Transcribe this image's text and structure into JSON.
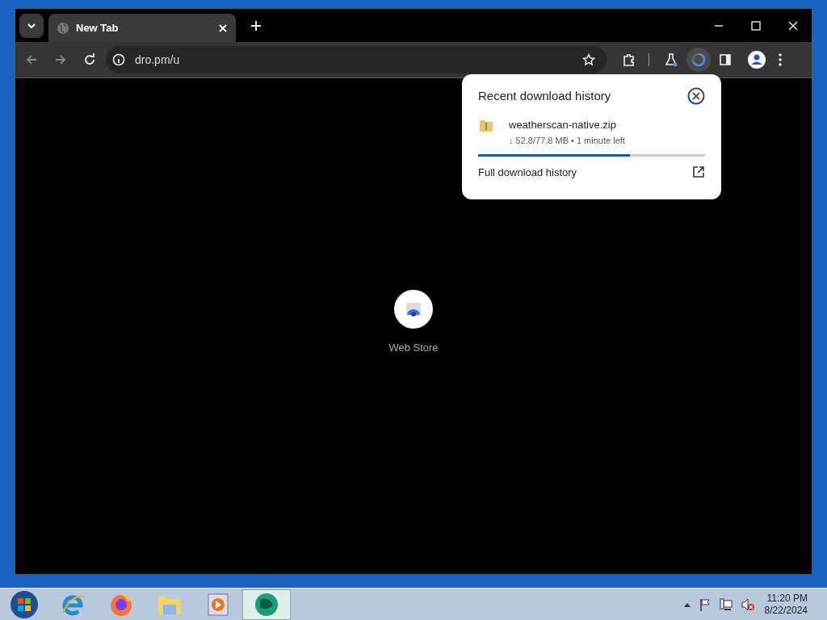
{
  "tab": {
    "title": "New Tab",
    "selected": true
  },
  "address_bar": {
    "url": "dro.pm/u"
  },
  "shortcut": {
    "label": "Web Store"
  },
  "download_popup": {
    "title": "Recent download history",
    "items": [
      {
        "filename": "weatherscan-native.zip",
        "status": "↓ 52.8/77.8 MB • 1 minute left",
        "level": 0.67
      }
    ],
    "link": "Full download history"
  },
  "taskbar": {
    "items": [
      {
        "kind": "start",
        "selected": false
      },
      {
        "kind": "ie",
        "selected": false
      },
      {
        "kind": "firefox",
        "selected": false
      },
      {
        "kind": "explorer",
        "selected": false
      },
      {
        "kind": "media",
        "selected": false
      },
      {
        "kind": "app",
        "selected": true
      }
    ]
  },
  "clock": {
    "time": "11:20 PM",
    "date": "8/22/2024"
  }
}
